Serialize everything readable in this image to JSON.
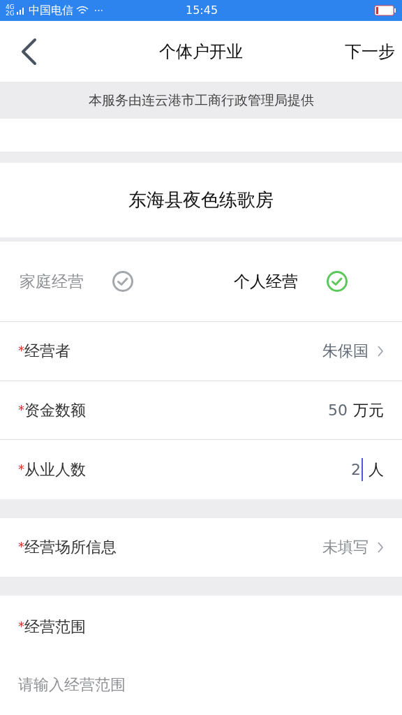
{
  "status_bar": {
    "network_top": "4G",
    "network_bottom": "2G",
    "carrier": "中国电信",
    "more": "···",
    "time": "15:45"
  },
  "nav": {
    "title": "个体户开业",
    "next": "下一步"
  },
  "banner": "本服务由连云港市工商行政管理局提供",
  "business_name": "东海县夜色练歌房",
  "operation_types": [
    {
      "label": "家庭经营",
      "selected": false
    },
    {
      "label": "个人经营",
      "selected": true
    }
  ],
  "rows": [
    {
      "kind": "select",
      "label": "经营者",
      "required_mark": "*",
      "value": "朱保国",
      "filled": true
    },
    {
      "kind": "amount",
      "label": "资金数额",
      "required_mark": "*",
      "value": "50",
      "unit": "万元"
    },
    {
      "kind": "count",
      "label": "从业人数",
      "required_mark": "*",
      "value": "2",
      "unit": "人",
      "focused": true
    }
  ],
  "place": {
    "kind": "select",
    "label": "经营场所信息",
    "required_mark": "*",
    "value": "未填写",
    "filled": false
  },
  "scope": {
    "label": "经营范围",
    "required_mark": "*",
    "placeholder": "请输入经营范围"
  }
}
